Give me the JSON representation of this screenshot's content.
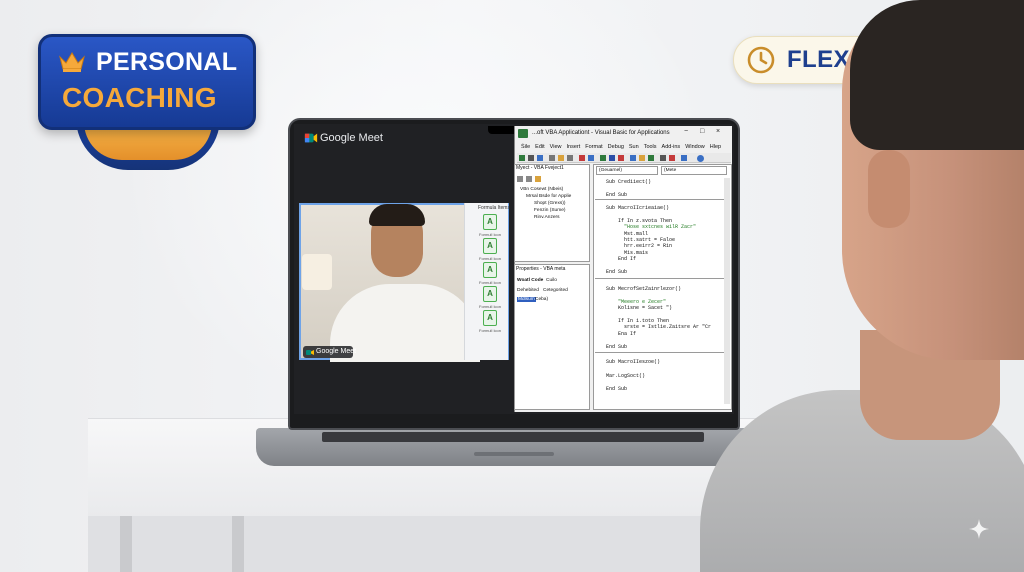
{
  "badges": {
    "personal": {
      "line1": "PERSONAL",
      "line2": "COACHING"
    },
    "time": {
      "label": "FLEXIBLE TIME",
      "icon": "clock-icon"
    }
  },
  "meet": {
    "app_name": "Google Meet",
    "pill_label": "Google Meet",
    "side_panel_title": "Formula Items",
    "side_items": [
      "Formull Icon",
      "Formull Icon",
      "Formull Icon",
      "Formull Icon",
      "Formull Icon"
    ]
  },
  "vba": {
    "title": "...oft VBA Applicationt - Visual Basic for Applications",
    "window_controls": [
      "−",
      "□",
      "×"
    ],
    "menu": [
      "Ṡile",
      "Eḋit",
      "View",
      "Insert",
      "Format",
      "Debug",
      "Sun",
      "Tools",
      "Add-ins",
      "Window",
      "Hlep"
    ],
    "project_title": "Myect - VBA Fveject1",
    "tree": [
      "VBn Cosewt (Nbeis)",
      "Mrsal Bsde for Applie",
      "Shopt (Grexs))",
      "Fenzin (Sume)",
      "Rinv.Anzers"
    ],
    "properties_title": "Properties - VBA meta",
    "properties": {
      "object": "Woatl Code",
      "object_value": "Cuilo",
      "tabs": [
        "Dehebited",
        "Cetegorited"
      ],
      "row_name": "Mdlsum",
      "row_value": "Ceba)"
    },
    "combo_left": "(Geuarnel)",
    "combo_right": "(Mete",
    "code_blocks": [
      [
        "Sub Crediiect()",
        "",
        "End Sub"
      ],
      [
        "Sub MacroIIcrieaiae()",
        "",
        "    If In z.svota Then",
        "      \"Hose sxtcnes wilR Zacr\"",
        "      Mst.mall",
        "      htt.satrt = Faloe",
        "      hrr.eeirr2 = Rin",
        "      Mis.mais",
        "    End If",
        "",
        "End Sub"
      ],
      [
        "Sub MecrofSetZainrlezor()",
        "",
        "    \"Meeero e Zecer\"",
        "    Kolisne = Sacet \")",
        "",
        "    If In i.toto Then",
        "      srste = Istlie.Zaitsre Ar \"Cr",
        "    Ena If",
        "",
        "End Sub"
      ],
      [
        "Sub MacroIIeszoe()"
      ],
      [
        "Mar.LogSoct()"
      ],
      [
        "End Sub"
      ]
    ]
  }
}
